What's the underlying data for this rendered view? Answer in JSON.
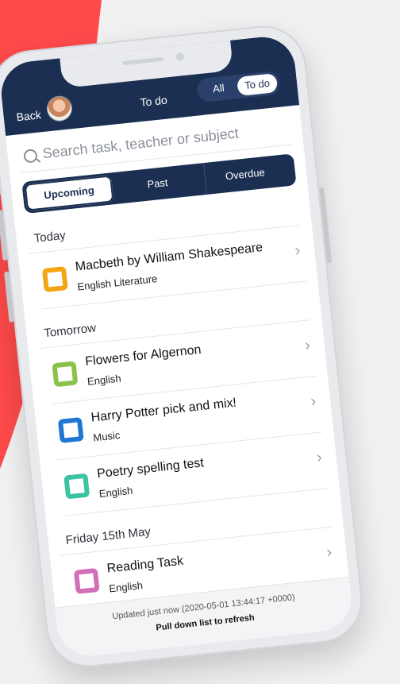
{
  "colors": {
    "navy": "#1b2f52",
    "accent_red": "#ff4a4a"
  },
  "header": {
    "back_label": "Back",
    "title": "To do",
    "toggle": {
      "all_label": "All",
      "todo_label": "To do",
      "selected": "To do"
    }
  },
  "search": {
    "placeholder": "Search task, teacher or subject"
  },
  "tabs": [
    {
      "label": "Upcoming",
      "selected": true
    },
    {
      "label": "Past",
      "selected": false
    },
    {
      "label": "Overdue",
      "selected": false
    }
  ],
  "sections": [
    {
      "label": "Today",
      "items": [
        {
          "title": "Macbeth by William Shakespeare",
          "subject": "English Literature",
          "color": "#f3a514",
          "icon": "chevron-right-icon"
        }
      ]
    },
    {
      "label": "Tomorrow",
      "items": [
        {
          "title": "Flowers for Algernon",
          "subject": "English",
          "color": "#8bc34a",
          "icon": "chevron-right-icon"
        },
        {
          "title": "Harry Potter pick and mix!",
          "subject": "Music",
          "color": "#1e78d2",
          "icon": "chevron-right-icon"
        },
        {
          "title": "Poetry spelling test",
          "subject": "English",
          "color": "#3cc3a2",
          "icon": "chevron-right-icon"
        }
      ]
    },
    {
      "label": "Friday 15th May",
      "items": [
        {
          "title": "Reading Task",
          "subject": "English",
          "color": "#d36fb8",
          "icon": "chevron-right-icon"
        }
      ]
    }
  ],
  "footer": {
    "updated": "Updated just now (2020-05-01 13:44:17 +0000)",
    "pull": "Pull down list to refresh"
  }
}
